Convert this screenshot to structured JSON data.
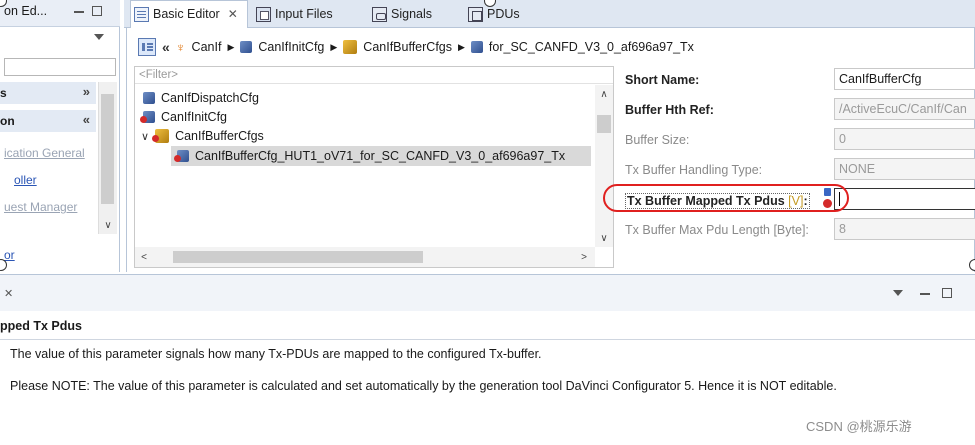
{
  "left_view": {
    "tab_label": "on Ed...",
    "sections": [
      {
        "label": "s"
      },
      {
        "label": "on"
      }
    ],
    "links": [
      "ication General",
      "oller",
      "uest Manager"
    ],
    "footer_link": "or"
  },
  "editor_tabs": [
    {
      "label": "Basic Editor",
      "icon": "editor-icon",
      "active": true
    },
    {
      "label": "Input Files",
      "icon": "input-files-icon"
    },
    {
      "label": "Signals",
      "icon": "signals-icon"
    },
    {
      "label": "PDUs",
      "icon": "pdus-icon"
    }
  ],
  "breadcrumb": [
    "CanIf",
    "CanIfInitCfg",
    "CanIfBufferCfgs",
    "for_SC_CANFD_V3_0_af696a97_Tx"
  ],
  "tree": {
    "filter_placeholder": "<Filter>",
    "items": [
      {
        "label": "CanIfDispatchCfg"
      },
      {
        "label": "CanIfInitCfg"
      },
      {
        "label": "CanIfBufferCfgs"
      },
      {
        "label": "CanIfBufferCfg_HUT1_oV71_for_SC_CANFD_V3_0_af696a97_Tx"
      }
    ]
  },
  "form": {
    "short_name_label": "Short Name:",
    "short_name_value": "CanIfBufferCfg",
    "hth_ref_label": "Buffer Hth Ref:",
    "hth_ref_value": "/ActiveEcuC/CanIf/Can",
    "buffer_size_label": "Buffer Size:",
    "buffer_size_value": "0",
    "handling_type_label": "Tx Buffer Handling Type:",
    "handling_type_value": "NONE",
    "mapped_pdus_label": "Tx Buffer Mapped Tx Pdus",
    "mapped_pdus_unit": "[V]",
    "mapped_pdus_colon": ":",
    "mapped_pdus_value": "",
    "max_pdu_label": "Tx Buffer Max Pdu Length [Byte]:",
    "max_pdu_value": "8"
  },
  "help": {
    "title": "pped Tx Pdus",
    "line1": "The value of this parameter signals how many Tx-PDUs are mapped to the configured Tx-buffer.",
    "line2": "Please NOTE: The value of this parameter is calculated and set automatically by the generation tool DaVinci Configurator 5. Hence it is NOT editable."
  },
  "watermark": "CSDN @桃源乐游",
  "colors": {
    "highlight_ring": "#e0201f",
    "selection_bg": "#d9d9d9",
    "panel_border": "#b7c5d8"
  }
}
